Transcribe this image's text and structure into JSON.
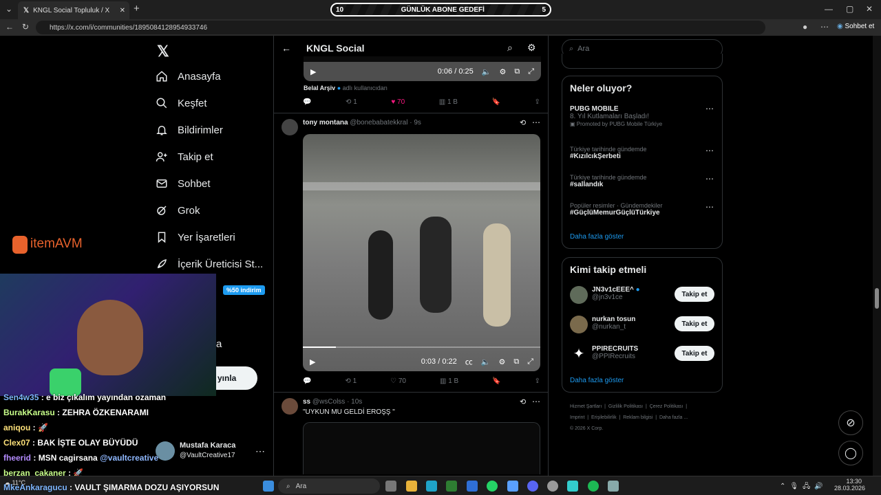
{
  "browser": {
    "tab_title": "KNGL Social Topluluk / X",
    "url": "https://x.com/i/communities/1895084128954933746",
    "chat_button": "Sohbet et",
    "goal": {
      "left": "10",
      "label": "GÜNLÜK ABONE GEDEFİ",
      "right": "5"
    }
  },
  "nav": {
    "items": [
      {
        "label": "Anasayfa",
        "icon": "home-icon"
      },
      {
        "label": "Keşfet",
        "icon": "search-icon"
      },
      {
        "label": "Bildirimler",
        "icon": "bell-icon"
      },
      {
        "label": "Takip et",
        "icon": "follow-icon"
      },
      {
        "label": "Sohbet",
        "icon": "mail-icon"
      },
      {
        "label": "Grok",
        "icon": "grok-icon"
      },
      {
        "label": "Yer İşaretleri",
        "icon": "bookmark-icon"
      },
      {
        "label": "İçerik Üreticisi St...",
        "icon": "rocket-icon"
      }
    ],
    "partial_label": "a",
    "post_button_partial": "yınla",
    "discount_badge": "%50 indirim",
    "account": {
      "name": "Mustafa Karaca",
      "handle": "@VaultCreative17"
    }
  },
  "overlay": {
    "logo_text": "itemAVM",
    "chat": [
      {
        "user": "Sen4w35",
        "text": ": e biz çıkalım yayından ozaman",
        "color": "#7fb7ff"
      },
      {
        "user": "BurakKarasu",
        "text": ": ZEHRA ÖZKENARAMI",
        "color": "#c8ff8a"
      },
      {
        "user": "aniqou",
        "text": ":",
        "color": "#ffe27a"
      },
      {
        "user": "Clex07",
        "text": ": BAK İŞTE OLAY BÜYÜDÜ",
        "color": "#ffe27a"
      },
      {
        "user": "fheerid",
        "text": ": MSN cagirsana ",
        "mention": "@vaultcreative",
        "color": "#b48cff"
      },
      {
        "user": "berzan_cakaner",
        "text": ":",
        "color": "#c8ff8a"
      },
      {
        "user": "MkeAnkaragucu",
        "text": ": VAULT ŞIMARMA DOZU AŞIYORSUN",
        "color": "#7fb7ff"
      }
    ]
  },
  "header": {
    "title": "KNGL Social"
  },
  "posts": [
    {
      "video_time": "0:06 / 0:25",
      "credit_name": "Belal Arşiv",
      "credit_suffix": "adlı kullanıcıdan",
      "replies": "",
      "reposts": "1",
      "likes": "70",
      "views": "1 B"
    },
    {
      "name": "tony montana",
      "handle": "@bonebabatekkral · 9s",
      "video_time": "0:03 / 0:22",
      "reposts": "1",
      "likes": "70",
      "views": "1 B"
    },
    {
      "name": "ss",
      "handle": "@wsColss · 10s",
      "text": "\"UYKUN MU GELDİ EROŞŞ \""
    }
  ],
  "search": {
    "placeholder": "Ara"
  },
  "trends": {
    "title": "Neler oluyor?",
    "items": [
      {
        "context": "",
        "name": "PUBG MOBILE",
        "sub": "8. Yıl Kutlamaları Başladı!",
        "promo": "Promoted by PUBG Mobile Türkiye"
      },
      {
        "context": "Türkiye tarihinde gündemde",
        "name": "#KızılcıkŞerbeti"
      },
      {
        "context": "Türkiye tarihinde gündemde",
        "name": "#sallandık"
      },
      {
        "context": "Popüler resimler · Gündemdekiler",
        "name": "#GüçlüMemurGüçlüTürkiye"
      }
    ],
    "more": "Daha fazla göster"
  },
  "who_to_follow": {
    "title": "Kimi takip etmeli",
    "users": [
      {
        "name": "JN3v1cEEE^",
        "handle": "@jn3v1ce",
        "button": "Takip et"
      },
      {
        "name": "nurkan tosun",
        "handle": "@nurkan_t",
        "button": "Takip et"
      },
      {
        "name": "PPIRECRUITS",
        "handle": "@PPIRecruits",
        "button": "Takip et"
      }
    ],
    "more": "Daha fazla göster"
  },
  "footer": {
    "links": [
      "Hizmet Şartları",
      "Gizlilik Politikası",
      "Çerez Politikası",
      "Imprint",
      "Erişilebilirlik",
      "Reklam bilgisi",
      "Daha fazla ..."
    ],
    "copyright": "© 2026 X Corp."
  },
  "taskbar": {
    "search": "Ara",
    "temp": "11°C",
    "time": "13:30",
    "date": "28.03.2026"
  }
}
